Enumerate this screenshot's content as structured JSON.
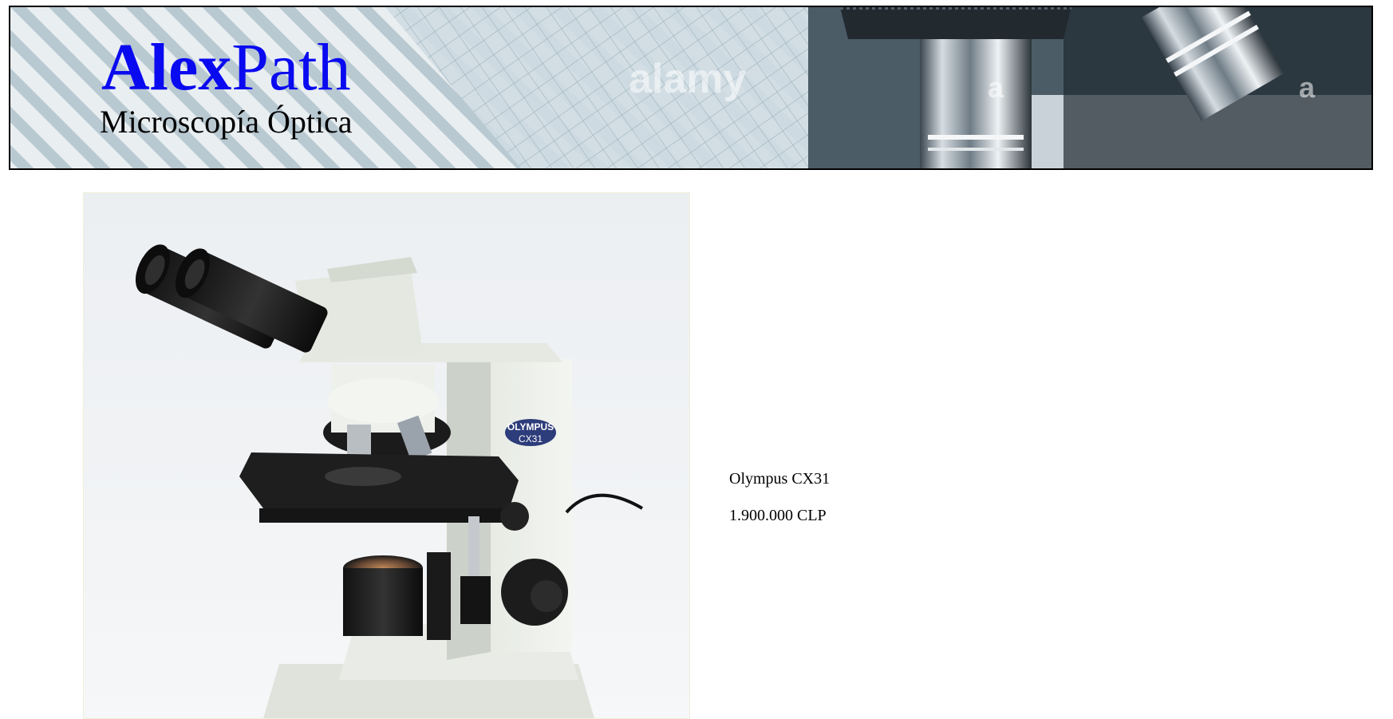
{
  "header": {
    "brand_part1": "Alex",
    "brand_part2": "Path",
    "subtitle": "Microscopía Óptica",
    "watermark": "alamy",
    "watermark_small": "a",
    "brand_color": "#0a0af0"
  },
  "product": {
    "name": "Olympus CX31",
    "price": "1.900.000 CLP",
    "image_label": "OLYMPUS",
    "model_badge": "CX31",
    "image_icon": "microscope-image"
  }
}
